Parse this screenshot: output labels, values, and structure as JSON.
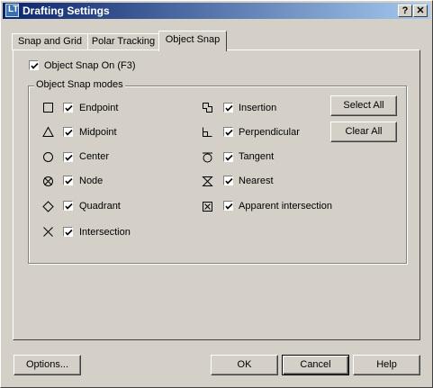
{
  "window": {
    "title": "Drafting Settings",
    "help_label": "?",
    "close_label": "✕"
  },
  "tabs": [
    {
      "label": "Snap and Grid"
    },
    {
      "label": "Polar Tracking"
    },
    {
      "label": "Object Snap",
      "active": true
    }
  ],
  "snap_on": {
    "label": "Object Snap On (F3)",
    "checked": true
  },
  "modes_group": {
    "title": "Object Snap modes"
  },
  "modes_left": [
    {
      "label": "Endpoint",
      "icon": "endpoint-marker-icon",
      "checked": true
    },
    {
      "label": "Midpoint",
      "icon": "midpoint-marker-icon",
      "checked": true
    },
    {
      "label": "Center",
      "icon": "center-marker-icon",
      "checked": true
    },
    {
      "label": "Node",
      "icon": "node-marker-icon",
      "checked": true
    },
    {
      "label": "Quadrant",
      "icon": "quadrant-marker-icon",
      "checked": true
    },
    {
      "label": "Intersection",
      "icon": "intersection-marker-icon",
      "checked": true
    }
  ],
  "modes_right": [
    {
      "label": "Insertion",
      "icon": "insertion-marker-icon",
      "checked": true
    },
    {
      "label": "Perpendicular",
      "icon": "perpendicular-marker-icon",
      "checked": true
    },
    {
      "label": "Tangent",
      "icon": "tangent-marker-icon",
      "checked": true
    },
    {
      "label": "Nearest",
      "icon": "nearest-marker-icon",
      "checked": true
    },
    {
      "label": "Apparent intersection",
      "icon": "apparent-intersection-marker-icon",
      "checked": true
    }
  ],
  "buttons": {
    "select_all": "Select All",
    "clear_all": "Clear All",
    "options": "Options...",
    "ok": "OK",
    "cancel": "Cancel",
    "help": "Help"
  }
}
